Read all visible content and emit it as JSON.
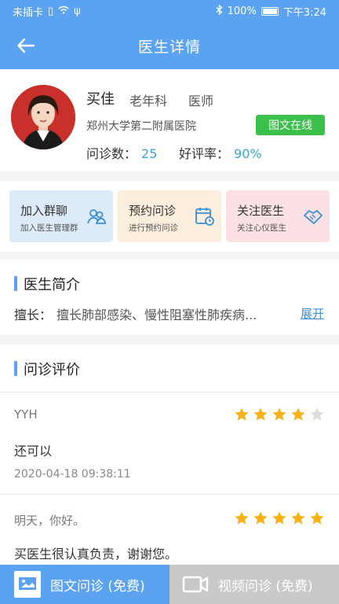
{
  "statusbar": {
    "left": "未插卡",
    "battery": "100%",
    "time": "下午3:24"
  },
  "nav": {
    "title": "医生详情"
  },
  "doctor": {
    "name": "买佳",
    "department": "老年科",
    "title": "医师",
    "hospital": "郑州大学第二附属医院",
    "online_badge": "图文在线",
    "consult_label": "问诊数：",
    "consult_count": "25",
    "rating_label": "好评率：",
    "rating_value": "90%"
  },
  "actions": [
    {
      "label": "加入群聊",
      "sub": "加入医生管理群",
      "bg": "#dcebf7",
      "icon": "chat-group-icon"
    },
    {
      "label": "预约问诊",
      "sub": "进行预约问诊",
      "bg": "#fbeedd",
      "icon": "calendar-icon"
    },
    {
      "label": "关注医生",
      "sub": "关注心仪医生",
      "bg": "#fbe1e4",
      "icon": "handshake-icon"
    }
  ],
  "intro": {
    "title": "医生简介",
    "label": "擅长：",
    "text": "擅长肺部感染、慢性阻塞性肺疾病...",
    "more": "展开"
  },
  "reviews": {
    "title": "问诊评价",
    "items": [
      {
        "user": "YYH",
        "content": "还可以",
        "time": "2020-04-18 09:38:11",
        "stars": 4
      },
      {
        "user": "明天，你好。",
        "content": "买医生很认真负责，谢谢您。",
        "time": "",
        "stars": 5
      }
    ]
  },
  "bottom": {
    "text_consult": "图文问诊 (免费)",
    "video_consult": "视频问诊 (免费)"
  },
  "colors": {
    "primary": "#5ba3f1",
    "online": "#3cbf4b",
    "star": "#f7b21a",
    "star_empty": "#dddddd"
  }
}
